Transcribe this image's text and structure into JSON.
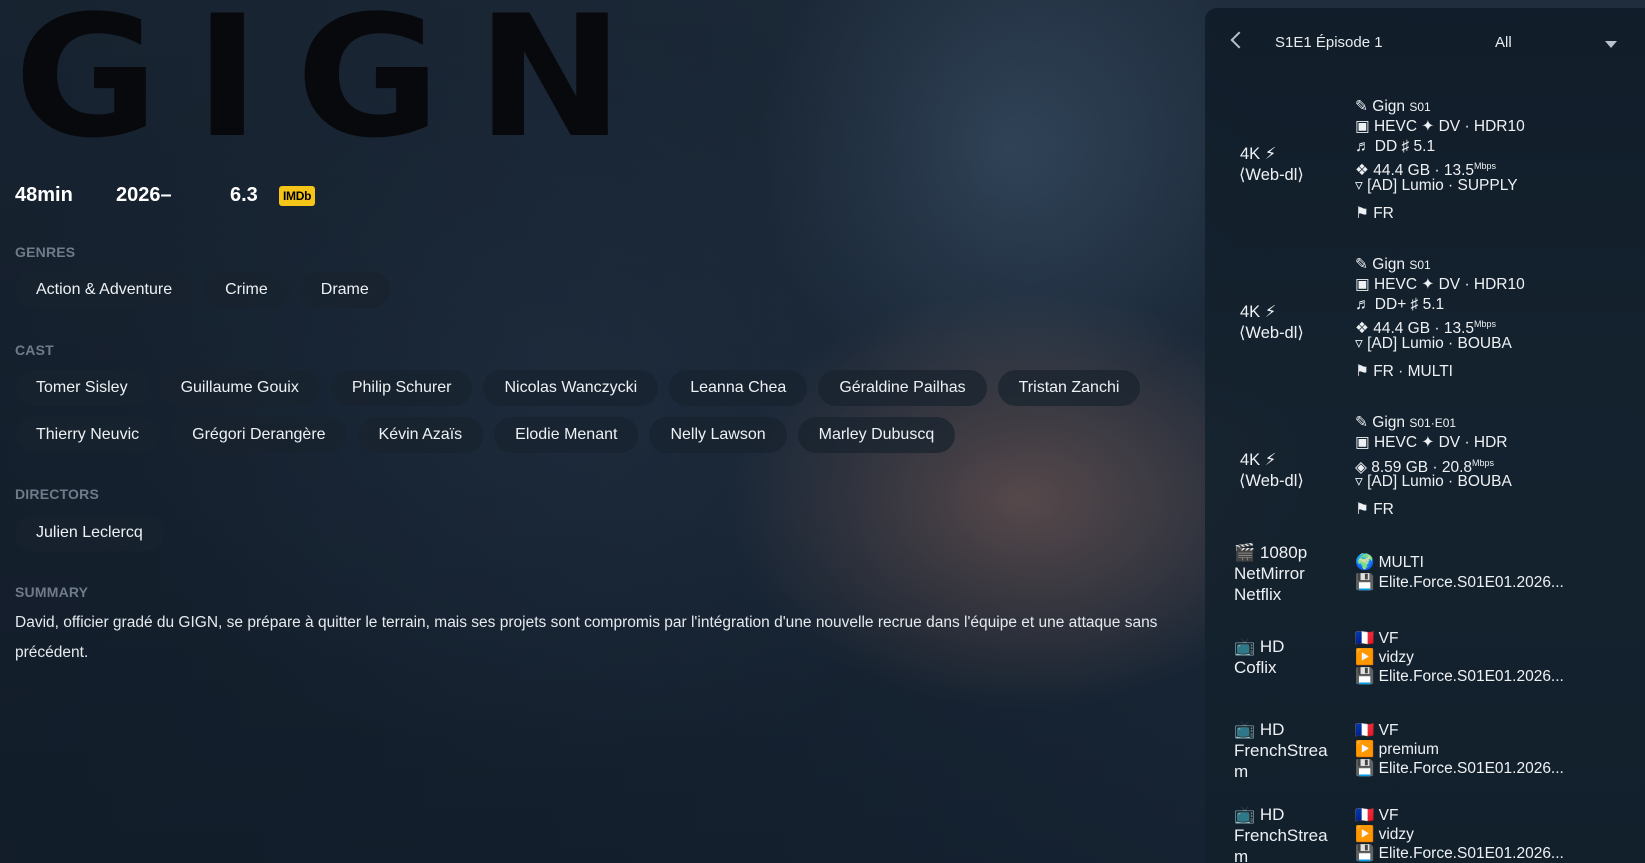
{
  "show": {
    "logo": "GIGN",
    "runtime": "48min",
    "year": "2026–",
    "rating": "6.3",
    "rating_badge": "IMDb"
  },
  "genres": {
    "title": "GENRES",
    "items": [
      "Action & Adventure",
      "Crime",
      "Drame"
    ]
  },
  "cast": {
    "title": "CAST",
    "row1": [
      "Tomer Sisley",
      "Guillaume Gouix",
      "Philip Schurer",
      "Nicolas Wanczycki",
      "Leanna Chea",
      "Géraldine Pailhas",
      "Tristan Zanchi"
    ],
    "row2": [
      "Thierry Neuvic",
      "Grégori Derangère",
      "Kévin Azaïs",
      "Elodie Menant",
      "Nelly Lawson",
      "Marley Dubuscq"
    ]
  },
  "directors": {
    "title": "DIRECTORS",
    "items": [
      "Julien Leclercq"
    ]
  },
  "summary": {
    "title": "SUMMARY",
    "text": "David, officier gradé du GIGN, se prépare à quitter le terrain, mais ses projets sont compromis par l'intégration d'une nouvelle recrue dans l'équipe et une attaque sans précédent."
  },
  "panel": {
    "episode": "S1E1 Épisode 1",
    "filter": "All",
    "sources": [
      {
        "q1": "4K  ⚡",
        "q2": "⟨Web-dl⟩",
        "name": "✎ Gign ",
        "name_tag": "S01",
        "video": "▣ HEVC ✦ DV · HDR10",
        "audio": "♬  DD ♯ 5.1",
        "size": "❖ 44.4 GB · 13.5",
        "unit": "Mbps",
        "group": "▿ [AD] Lumio · SUPPLY",
        "langs": "⚑ FR"
      },
      {
        "q1": "4K  ⚡",
        "q2": "⟨Web-dl⟩",
        "name": "✎ Gign ",
        "name_tag": "S01",
        "video": "▣ HEVC ✦ DV · HDR10",
        "audio": "♬  DD+ ♯ 5.1",
        "size": "❖ 44.4 GB · 13.5",
        "unit": "Mbps",
        "group": "▿ [AD] Lumio · BOUBA",
        "langs": "⚑ FR · MULTI"
      },
      {
        "q1": "4K  ⚡",
        "q2": "⟨Web-dl⟩",
        "name": "✎ Gign ",
        "name_tag": "S01·E01",
        "video": "▣ HEVC ✦ DV · HDR",
        "size": "◈ 8.59 GB · 20.8",
        "unit": "Mbps",
        "group": "▿ [AD] Lumio · BOUBA",
        "langs": "⚑ FR"
      },
      {
        "q1": "🎬 1080p",
        "q2": "NetMirror",
        "q3": "Netflix",
        "l1": "🌍 MULTI",
        "l2": "💾 Elite.Force.S01E01.2026..."
      },
      {
        "q1": "📺 HD",
        "q2": "Coflix",
        "l1": "🇫🇷 VF",
        "l2": "▶️ vidzy",
        "l3": "💾 Elite.Force.S01E01.2026..."
      },
      {
        "q1": "📺 HD",
        "q2": "FrenchStrea",
        "q3": "m",
        "l1": "🇫🇷 VF",
        "l2": "▶️ premium",
        "l3": "💾 Elite.Force.S01E01.2026..."
      },
      {
        "q1": "📺 HD",
        "q2": "FrenchStrea",
        "q3": "m",
        "l1": "🇫🇷 VF",
        "l2": "▶️ vidzy",
        "l3": "💾 Elite.Force.S01E01.2026..."
      }
    ]
  }
}
